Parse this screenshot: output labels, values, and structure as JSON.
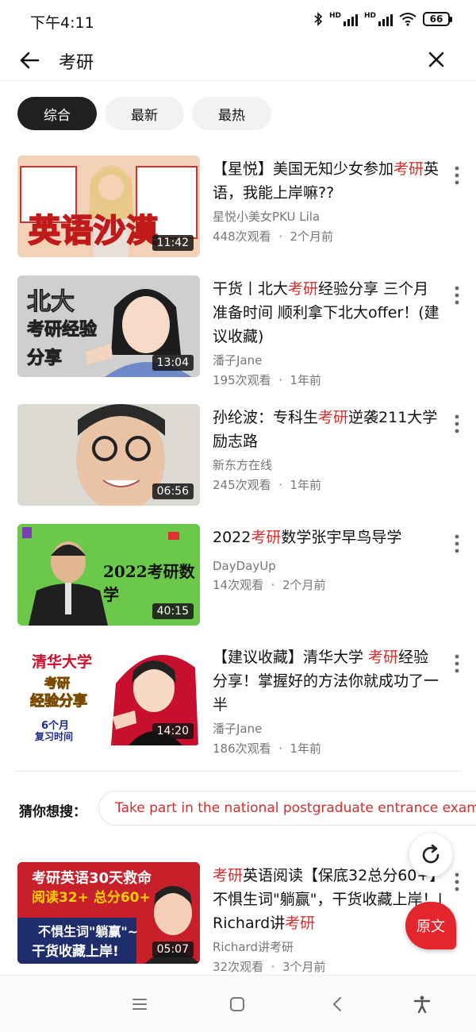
{
  "status_bar": {
    "time": "下午4:11",
    "battery": "66",
    "signal_label_1": "HD",
    "signal_label_2": "HD"
  },
  "search": {
    "query": "考研"
  },
  "filters": [
    {
      "label": "综合",
      "active": true
    },
    {
      "label": "最新",
      "active": false
    },
    {
      "label": "最热",
      "active": false
    }
  ],
  "videos": [
    {
      "title_parts": [
        "【星悦】美国无知少女参加",
        "考研",
        "英语，我能上岸嘛??"
      ],
      "channel": "星悦小美女PKU Lila",
      "views": "448次观看",
      "age": "2个月前",
      "duration": "11:42",
      "thumb_text": [
        "英语沙漠"
      ]
    },
    {
      "title_parts": [
        "干货丨北大",
        "考研",
        "经验分享 三个月准备时间 顺利拿下北大offer！(建议收藏)"
      ],
      "channel": "潘子Jane",
      "views": "195次观看",
      "age": "1年前",
      "duration": "13:04",
      "thumb_text": [
        "北大",
        "考研经验",
        "分享"
      ]
    },
    {
      "title_parts": [
        "孙纶波：专科生",
        "考研",
        "逆袭211大学励志路"
      ],
      "channel": "新东方在线",
      "views": "245次观看",
      "age": "1年前",
      "duration": "06:56",
      "thumb_text": []
    },
    {
      "title_parts": [
        "2022",
        "考研",
        "数学张宇早鸟导学"
      ],
      "channel": "DayDayUp",
      "views": "14次观看",
      "age": "2个月前",
      "duration": "40:15",
      "thumb_text": [
        "2022考研数学"
      ]
    },
    {
      "title_parts": [
        "【建议收藏】清华大学 ",
        "考研",
        "经验分享！掌握好的方法你就成功了一半"
      ],
      "channel": "潘子Jane",
      "views": "186次观看",
      "age": "1年前",
      "duration": "14:20",
      "thumb_text": [
        "清华大学",
        "考研",
        "经验分享",
        "6个月",
        "复习时间"
      ]
    },
    {
      "title_parts": [
        "",
        "考研",
        "英语阅读【保底32总分60+】不惧生词\"躺赢\"，干货收藏上岸！| Richard讲",
        "考研"
      ],
      "channel": "Richard讲考研",
      "views": "32次观看",
      "age": "3个月前",
      "duration": "05:07",
      "thumb_text": [
        "考研英语30天救命",
        "阅读32+ 总分60+",
        "不惧生词\"躺赢\"~",
        "干货收藏上岸!"
      ]
    }
  ],
  "guess": {
    "label": "猜你想搜：",
    "suggestion": "Take part in the national postgraduate entrance exam"
  },
  "original_button": "原文",
  "meta_separator": "·",
  "colors": {
    "highlight": "#d32f2f",
    "chip_active_bg": "#202020",
    "original_button_bg": "#e3262e"
  }
}
